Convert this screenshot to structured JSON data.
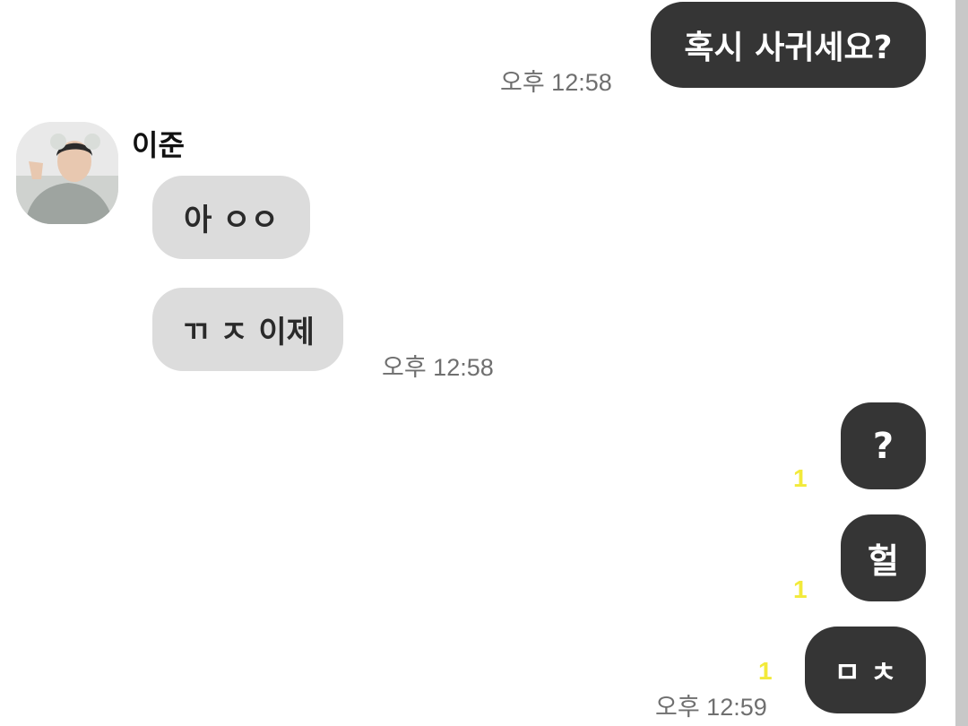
{
  "colors": {
    "my_bubble": "#353535",
    "their_bubble": "#dcdcdc",
    "read_count": "#f2ea3a",
    "timestamp": "#6f6f6f"
  },
  "messages": {
    "m1": {
      "text": "혹시 사귀세요?",
      "time": "오후 12:58"
    },
    "sender": {
      "name": "이준",
      "avatar": "profile-photo"
    },
    "m2": {
      "text": "아 ㅇㅇ"
    },
    "m3": {
      "text": "ㄲ ㅈ 이제",
      "time": "오후 12:58"
    },
    "m4": {
      "text": "?",
      "read": "1"
    },
    "m5": {
      "text": "헐",
      "read": "1"
    },
    "m6": {
      "text": "ㅁ ㅊ",
      "read": "1",
      "time": "오후 12:59"
    }
  }
}
